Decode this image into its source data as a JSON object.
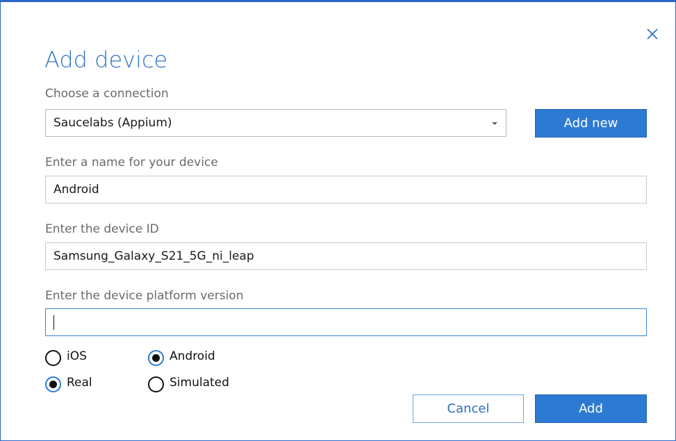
{
  "dialog": {
    "title": "Add device",
    "close_icon": "close-icon"
  },
  "connection": {
    "label": "Choose a connection",
    "selected": "Saucelabs (Appium)",
    "add_new_label": "Add new"
  },
  "device_name": {
    "label": "Enter a name for your device",
    "value": "Android"
  },
  "device_id": {
    "label": "Enter the device ID",
    "value": "Samsung_Galaxy_S21_5G_ni_leap"
  },
  "platform_version": {
    "label": "Enter the device platform version",
    "value": ""
  },
  "platform": {
    "options": [
      "iOS",
      "Android"
    ],
    "selected": "Android"
  },
  "device_type": {
    "options": [
      "Real",
      "Simulated"
    ],
    "selected": "Real"
  },
  "actions": {
    "cancel_label": "Cancel",
    "add_label": "Add"
  },
  "colors": {
    "accent": "#2d7ad3",
    "title": "#2f74c5",
    "border": "#2b66c8"
  }
}
